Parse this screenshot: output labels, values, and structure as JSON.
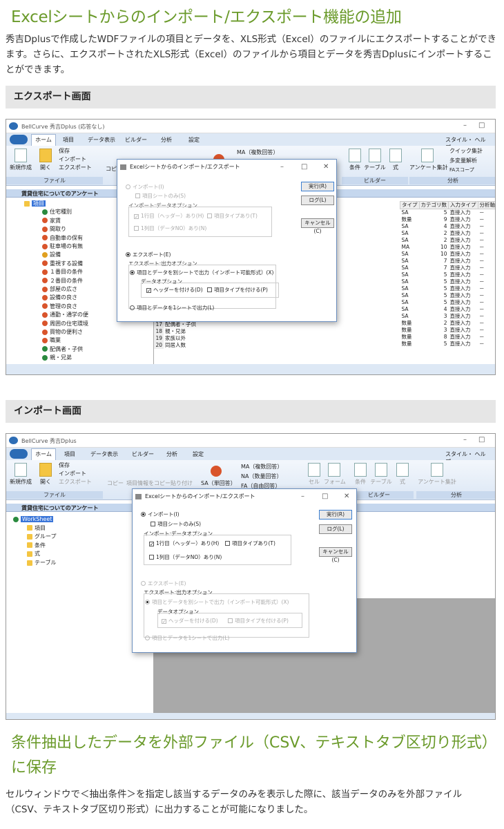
{
  "section1": {
    "heading": "Excelシートからのインポート/エクスポート機能の追加",
    "paragraph": "秀吉Dplusで作成したWDFファイルの項目とデータを、XLS形式（Excel）のファイルにエクスポートすることができます。さらに、エクスポートされたXLS形式（Excel）のファイルから項目とデータを秀吉Dplusにインポートすることができます。"
  },
  "band1": "エクスポート画面",
  "band2": "インポート画面",
  "section2": {
    "heading": "条件抽出したデータを外部ファイル（CSV、テキストタブ区切り形式）に保存",
    "paragraph": "セルウィンドウで＜抽出条件＞を指定し該当するデータのみを表示した際に、該当データのみを外部ファイル（CSV、テキストタブ区切り形式）に出力することが可能になりました。"
  },
  "app": {
    "title1": "BellCurve 秀吉Dplus (応答なし)",
    "title2": "BellCurve 秀吉Dplus",
    "tabs": [
      "ホーム",
      "項目",
      "データ表示",
      "ビルダー",
      "分析",
      "設定"
    ],
    "right_menu": "スタイル・ ヘルプ・",
    "file_group": "ファイル",
    "new": "新規作成",
    "open": "開く",
    "save": "保存",
    "import": "インポート",
    "export": "エクスポート",
    "copy": "コピー",
    "copy_item": "項目情報をコピー",
    "paste": "貼り付け",
    "sa": "SA（単回答）",
    "ma": "MA（複数回答）",
    "na": "NA（数量回答）",
    "fa": "FA（自由回答）",
    "cell": "セル",
    "form": "フォーム",
    "cond": "条件",
    "table": "テーブル",
    "formula": "式",
    "builder_group": "ビルダー",
    "enquete": "アンケート集計",
    "quick": "クイック集計",
    "multi": "多変量解析",
    "fascope": "FAスコープ",
    "analysis_group": "分析",
    "doc_tab": "賃貸住宅についてのアンケート"
  },
  "tree1": [
    "項目",
    "住宅種別",
    "家賃",
    "間取り",
    "自動車の保有",
    "駐車場の有無",
    "設備",
    "重視する設備",
    "１番目の条件",
    "２番目の条件",
    "部屋の広さ",
    "設備の良さ",
    "管理の良さ",
    "通勤・通学の便",
    "周囲の住宅環境",
    "買物の便利さ",
    "職業",
    "配偶者・子供",
    "親・兄弟"
  ],
  "grid_header": [
    "タイプ",
    "カテゴリ数",
    "入力タイプ",
    "分析軸"
  ],
  "grid_rows": [
    [
      "SA",
      "5",
      "直接入力",
      "－"
    ],
    [
      "数量",
      "9",
      "直接入力",
      "－"
    ],
    [
      "SA",
      "4",
      "直接入力",
      "－"
    ],
    [
      "SA",
      "2",
      "直接入力",
      "－"
    ],
    [
      "SA",
      "2",
      "直接入力",
      "－"
    ],
    [
      "MA",
      "10",
      "直接入力",
      "－"
    ],
    [
      "SA",
      "10",
      "直接入力",
      "－"
    ],
    [
      "SA",
      "7",
      "直接入力",
      "－"
    ],
    [
      "SA",
      "7",
      "直接入力",
      "－"
    ],
    [
      "SA",
      "5",
      "直接入力",
      "－"
    ],
    [
      "SA",
      "5",
      "直接入力",
      "－"
    ],
    [
      "SA",
      "5",
      "直接入力",
      "－"
    ],
    [
      "SA",
      "5",
      "直接入力",
      "－"
    ],
    [
      "SA",
      "5",
      "直接入力",
      "－"
    ],
    [
      "SA",
      "4",
      "直接入力",
      "－"
    ],
    [
      "SA",
      "3",
      "直接入力",
      "－"
    ],
    [
      "数量",
      "2",
      "直接入力",
      "－"
    ],
    [
      "数量",
      "3",
      "直接入力",
      "－"
    ],
    [
      "数量",
      "8",
      "直接入力",
      "－"
    ],
    [
      "数量",
      "5",
      "直接入力",
      "－"
    ]
  ],
  "grid_left_rows": [
    [
      "17",
      "配偶者・子供"
    ],
    [
      "18",
      "親・兄弟"
    ],
    [
      "19",
      "家族以外"
    ],
    [
      "20",
      "同居人数"
    ]
  ],
  "dialog": {
    "title": "Excelシートからのインポート/エクスポート",
    "import": "インポート(I)",
    "sheet_only": "項目シートのみ(S)",
    "import_opt": "インポート:データオプション",
    "row1": "1行目（ヘッダー）あり(H)",
    "item_type": "項目タイプあり(T)",
    "col1": "1列目（データNO）あり(N)",
    "export": "エクスポート(E)",
    "export_opt": "エクスポート:出力オプション",
    "separate": "項目とデータを別シートで出力（インポート可能形式）(X)",
    "data_opt": "データオプション",
    "header": "ヘッダーを付ける(D)",
    "add_type": "項目タイプを付ける(P)",
    "one_sheet": "項目とデータを1シートで出力(L)",
    "run": "実行(R)",
    "log": "ログ(L)",
    "cancel": "キャンセル(C)"
  },
  "tree2": [
    "WorkSheet",
    "項目",
    "グループ",
    "条件",
    "式",
    "テーブル"
  ],
  "colors": {
    "heading": "#6a9a2a",
    "band": "#e6e6e6",
    "ribbon": "#dce7f5"
  }
}
